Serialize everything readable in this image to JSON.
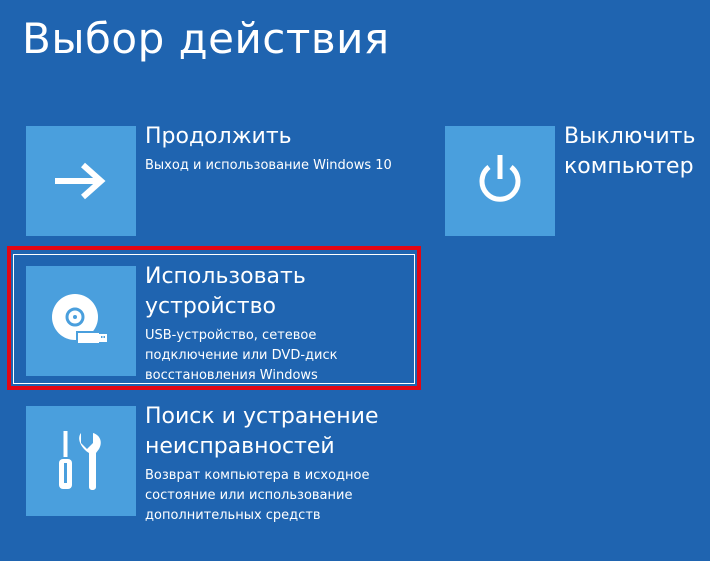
{
  "page": {
    "title": "Выбор действия"
  },
  "options": {
    "continue": {
      "title": "Продолжить",
      "description": "Выход и использование Windows 10",
      "icon": "arrow-right-icon"
    },
    "shutdown": {
      "title_line1": "Выключить",
      "title_line2": "компьютер",
      "icon": "power-icon"
    },
    "use_device": {
      "title_line1": "Использовать",
      "title_line2": "устройство",
      "desc_line1": "USB-устройство, сетевое",
      "desc_line2": "подключение или DVD-диск",
      "desc_line3": "восстановления Windows",
      "icon": "disc-usb-icon",
      "selected": true
    },
    "troubleshoot": {
      "title_line1": "Поиск и устранение",
      "title_line2": "неисправностей",
      "desc_line1": "Возврат компьютера в исходное",
      "desc_line2": "состояние или использование",
      "desc_line3": "дополнительных средств",
      "icon": "tools-icon"
    }
  },
  "colors": {
    "background": "#1f64b0",
    "tile": "#4a9fdd",
    "highlight": "#e30613"
  }
}
